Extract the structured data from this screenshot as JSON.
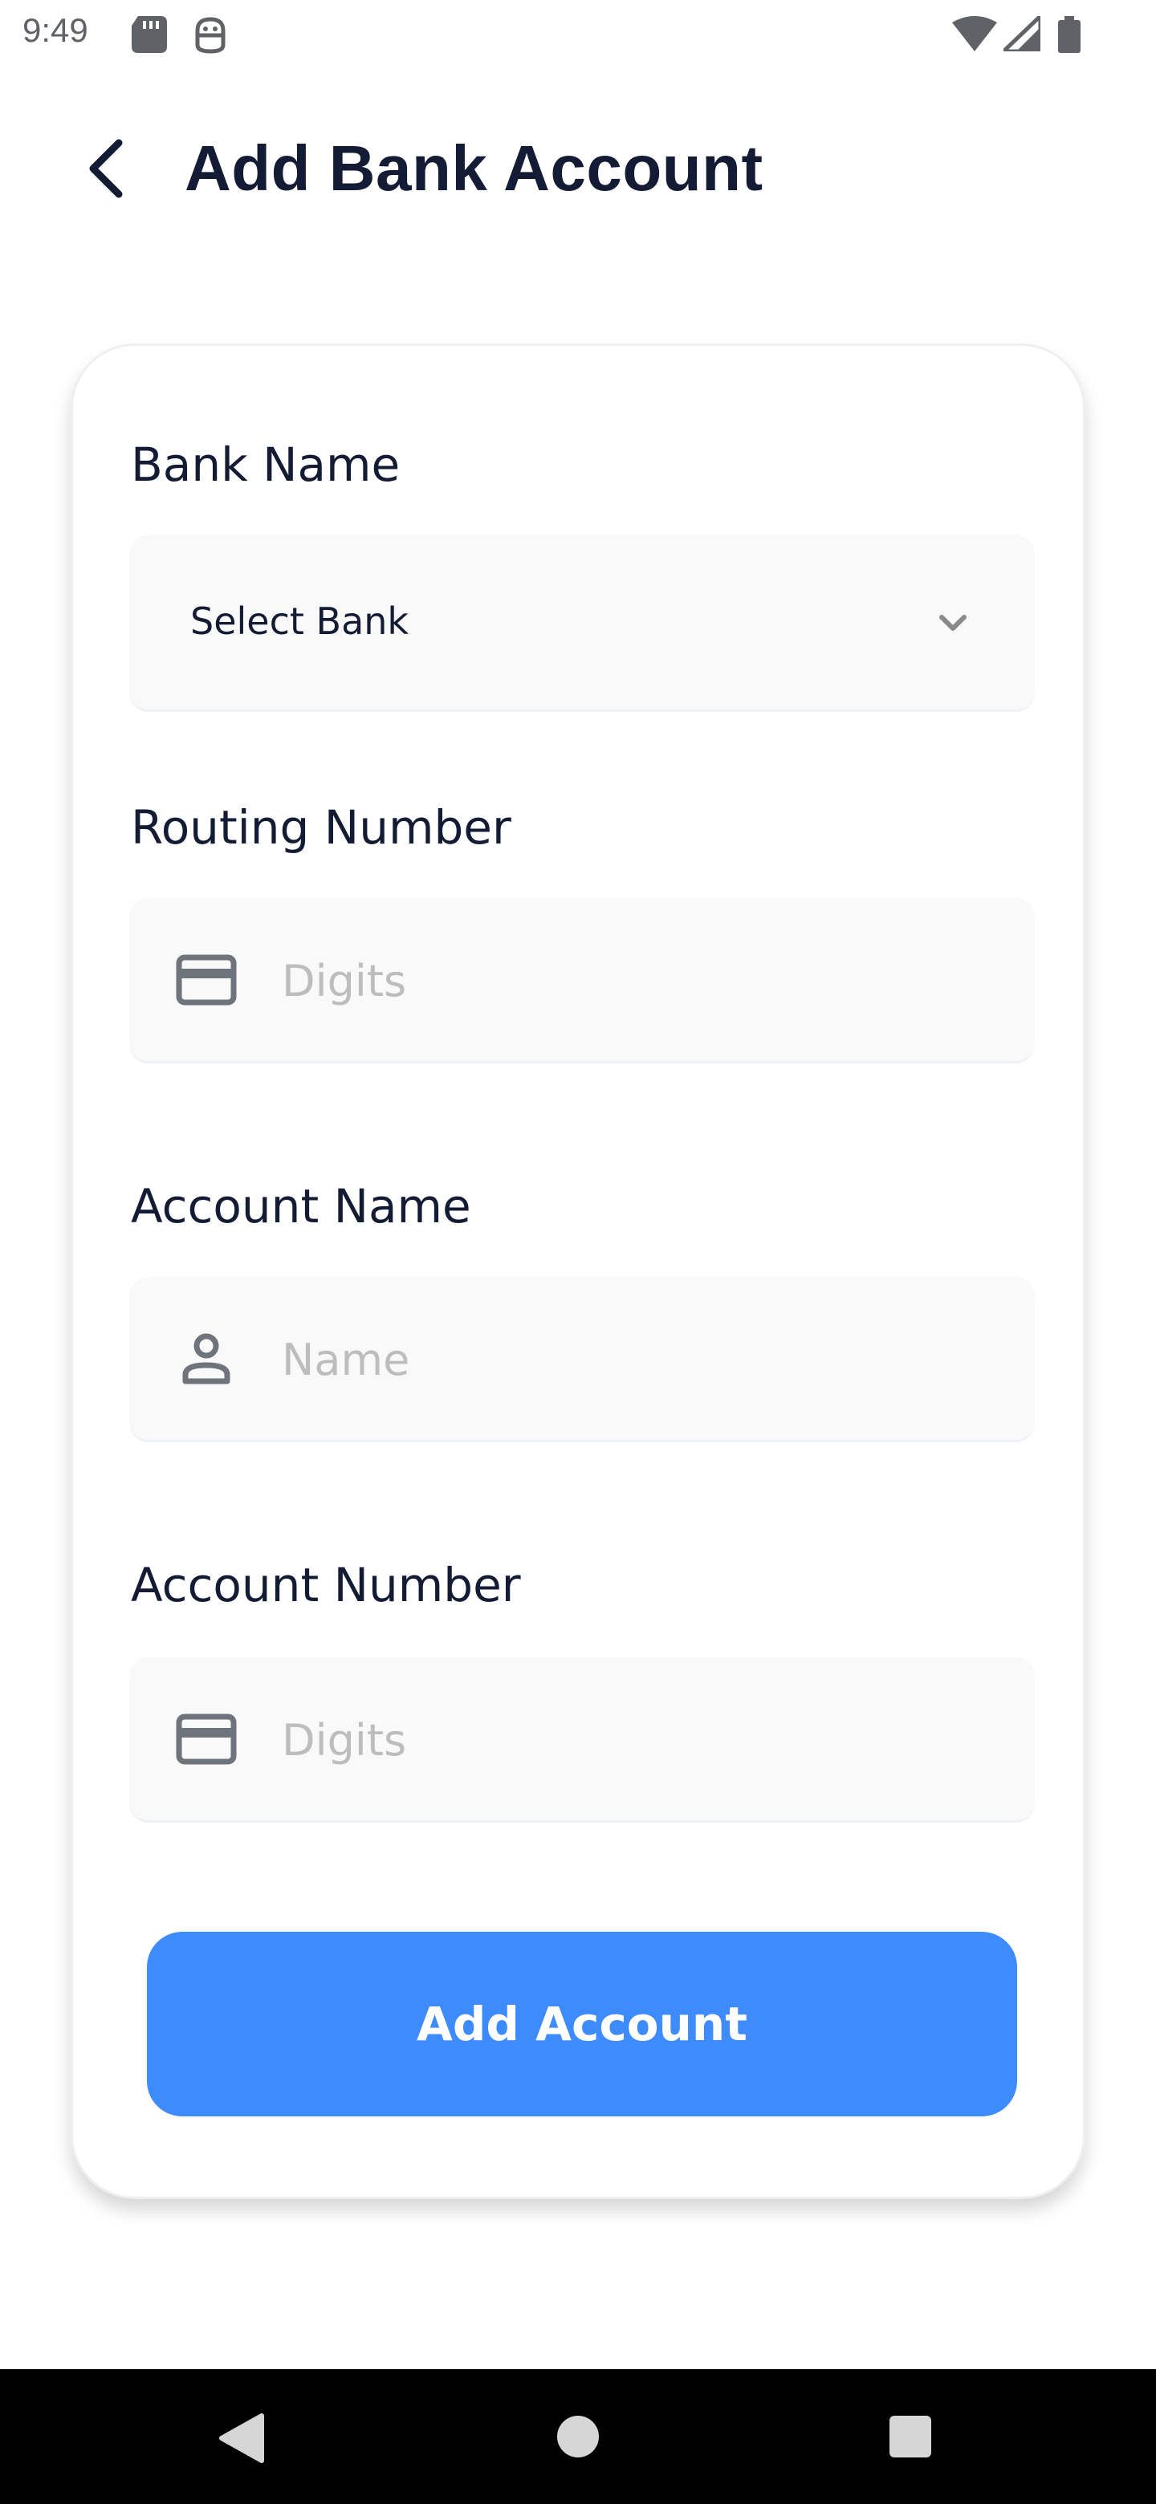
{
  "status_bar": {
    "time": "9:49",
    "icons": [
      "sd-card-icon",
      "android-debug-icon",
      "wifi-icon",
      "signal-icon",
      "battery-icon"
    ]
  },
  "header": {
    "title": "Add Bank Account",
    "back_icon": "chevron-left-icon"
  },
  "form": {
    "bank_name": {
      "label": "Bank Name",
      "value": "Select Bank",
      "icon": "chevron-down-icon"
    },
    "routing_number": {
      "label": "Routing Number",
      "placeholder": "Digits",
      "icon": "credit-card-icon"
    },
    "account_name": {
      "label": "Account Name",
      "placeholder": "Name",
      "icon": "person-icon"
    },
    "account_number": {
      "label": "Account Number",
      "placeholder": "Digits",
      "icon": "credit-card-icon"
    },
    "submit_label": "Add Account"
  },
  "colors": {
    "primary": "#3d8bfd",
    "title_text": "#141b34",
    "field_background": "#f9f9f9",
    "placeholder": "#bdbdbd"
  },
  "nav_bar": {
    "buttons": [
      "nav-back-icon",
      "nav-home-icon",
      "nav-recents-icon"
    ]
  }
}
